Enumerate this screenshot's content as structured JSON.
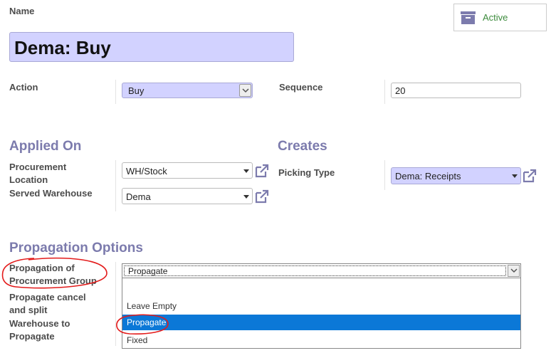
{
  "name_label": "Name",
  "name_value": "Dema:  Buy",
  "active_button": {
    "label": "Active",
    "icon": "archive-icon"
  },
  "action": {
    "label": "Action",
    "value": "Buy"
  },
  "sequence": {
    "label": "Sequence",
    "value": "20"
  },
  "applied_on": {
    "title": "Applied On",
    "procurement_location": {
      "label_line1": "Procurement",
      "label_line2": "Location",
      "value": "WH/Stock"
    },
    "served_warehouse": {
      "label": "Served Warehouse",
      "value": "Dema"
    }
  },
  "creates": {
    "title": "Creates",
    "picking_type": {
      "label": "Picking Type",
      "value": "Dema: Receipts"
    }
  },
  "propagation": {
    "title": "Propagation Options",
    "group_label_line1": "Propagation of",
    "group_label_line2": "Procurement Group",
    "selected": "Propagate",
    "options": [
      "Leave Empty",
      "Propagate",
      "Fixed"
    ],
    "cancel_label_line1": "Propagate cancel",
    "cancel_label_line2": "and split",
    "warehouse_label_line1": "Warehouse to",
    "warehouse_label_line2": "Propagate"
  },
  "colors": {
    "section_title": "#7c7bad",
    "input_highlight": "#d2d2ff",
    "active_green": "#3d8b3d",
    "selected_option": "#0b78d7",
    "annotation_red": "#e31b1b"
  }
}
